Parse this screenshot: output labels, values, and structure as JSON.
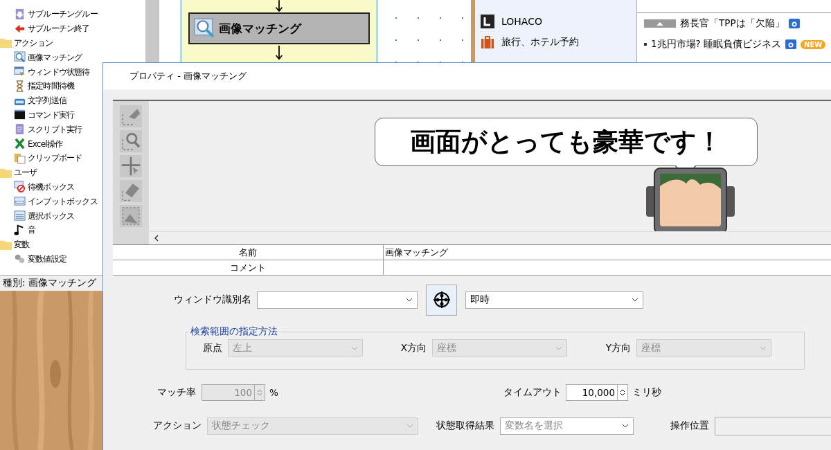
{
  "tree": {
    "items": [
      {
        "label": "サブルーチングルー"
      },
      {
        "label": "サブルーチン終了"
      },
      {
        "label": "アクション",
        "children": [
          {
            "label": "画像マッチング"
          },
          {
            "label": "ウィンドウ状態待"
          },
          {
            "label": "指定時間待機"
          },
          {
            "label": "文字列送信"
          },
          {
            "label": "コマンド実行"
          },
          {
            "label": "スクリプト実行"
          },
          {
            "label": "Excel操作"
          },
          {
            "label": "クリップボード"
          }
        ]
      },
      {
        "label": "ユーザ",
        "children": [
          {
            "label": "待機ボックス"
          },
          {
            "label": "インプットボックス"
          },
          {
            "label": "選択ボックス"
          },
          {
            "label": "音"
          }
        ]
      },
      {
        "label": "変数",
        "children": [
          {
            "label": "変数値設定"
          }
        ]
      }
    ]
  },
  "status_bar": "種別: 画像マッチング",
  "flow": {
    "node": {
      "label": "画像マッチング",
      "selected": true
    }
  },
  "browser": {
    "links": [
      {
        "label": "LOHACO"
      },
      {
        "label": "旅行、ホテル予約"
      }
    ],
    "news": [
      {
        "text": "務長官「TPPは「欠陥」",
        "photo": true
      },
      {
        "text": "1兆円市場? 睡眠負債ビジネス",
        "photo": true,
        "badge": "NEW"
      }
    ]
  },
  "dialog": {
    "title": "プロパティ - 画像マッチング",
    "balloon": "画面がとっても豪華です！",
    "properties": [
      {
        "name": "名前",
        "value": "画像マッチング"
      },
      {
        "name": "コメント"
      }
    ],
    "window_id": {
      "label": "ウィンドウ識別名"
    },
    "timing": {
      "value": "即時"
    },
    "search_range": {
      "legend": "検索範囲の指定方法",
      "fields": [
        {
          "label": "原点",
          "value": "左上",
          "disabled": true
        },
        {
          "label": "X方向",
          "value": "座標",
          "disabled": true
        },
        {
          "label": "Y方向",
          "value": "座標",
          "disabled": true
        }
      ]
    },
    "match_rate": {
      "label": "マッチ率",
      "value": "100",
      "unit": "%",
      "disabled": true
    },
    "timeout": {
      "label": "タイムアウト",
      "value": "10,000",
      "unit": "ミリ秒",
      "disabled": false
    },
    "action": {
      "label": "アクション",
      "value": "状態チェック",
      "disabled": true
    },
    "result": {
      "label": "状態取得結果",
      "placeholder": "変数名を選択"
    },
    "position": {
      "label": "操作位置"
    }
  }
}
